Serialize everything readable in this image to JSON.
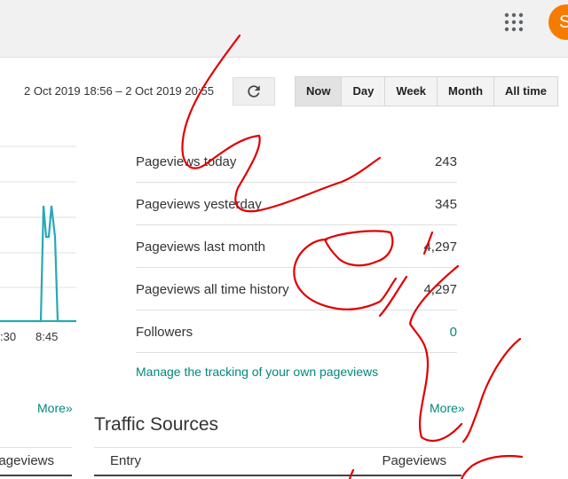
{
  "header": {
    "avatar_letter": "S",
    "apps_icon": "apps-grid-icon"
  },
  "toolbar": {
    "date_range": "2 Oct 2019 18:56 – 2 Oct 2019 20:55",
    "refresh_icon": "refresh-icon",
    "periods": [
      "Now",
      "Day",
      "Week",
      "Month",
      "All time"
    ],
    "active_period": "Now"
  },
  "chart": {
    "tick_labels": [
      ":30",
      "8:45"
    ],
    "line_color": "#26a9b6",
    "more_label": "More»"
  },
  "stats": [
    {
      "label": "Pageviews today",
      "value": "243"
    },
    {
      "label": "Pageviews yesterday",
      "value": "345"
    },
    {
      "label": "Pageviews last month",
      "value": "4,297"
    },
    {
      "label": "Pageviews all time history",
      "value": "4,297"
    },
    {
      "label": "Followers",
      "value": "0"
    }
  ],
  "manage_link": "Manage the tracking of your own pageviews",
  "stats_more_label": "More»",
  "traffic": {
    "title": "Traffic Sources",
    "col_entry": "Entry",
    "col_pageviews": "Pageviews"
  },
  "left_table": {
    "col_pageviews": "Pageviews"
  },
  "colors": {
    "accent": "#00897b",
    "avatar": "#f57c00",
    "scribble": "#e00000"
  }
}
